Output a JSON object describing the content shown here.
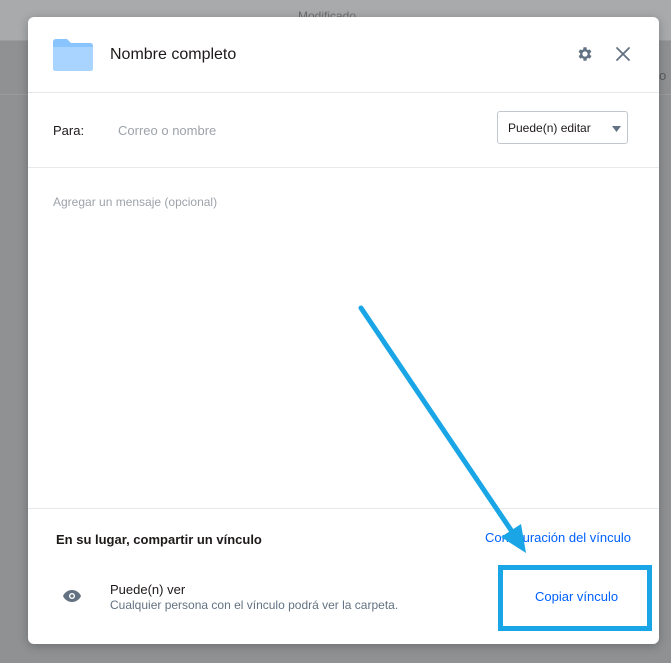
{
  "background": {
    "column_header": "Modificado",
    "right_edge_char": "o"
  },
  "dialog": {
    "title": "Nombre completo",
    "icons": {
      "folder": "folder-icon",
      "settings": "gear-icon",
      "close": "close-icon"
    }
  },
  "share": {
    "to_label": "Para:",
    "to_placeholder": "Correo o nombre",
    "permission_selected": "Puede(n) editar",
    "message_placeholder": "Agregar un mensaje (opcional)"
  },
  "link": {
    "heading": "En su lugar, compartir un vínculo",
    "settings_label": "Configuración del vínculo",
    "permission_title": "Puede(n) ver",
    "permission_description": "Cualquier persona con el vínculo podrá ver la carpeta.",
    "copy_label": "Copiar vínculo",
    "icon": "eye-icon"
  },
  "colors": {
    "accent": "#0061fe",
    "annotation": "#1aa6e6",
    "folder": "#8ac4ff"
  }
}
